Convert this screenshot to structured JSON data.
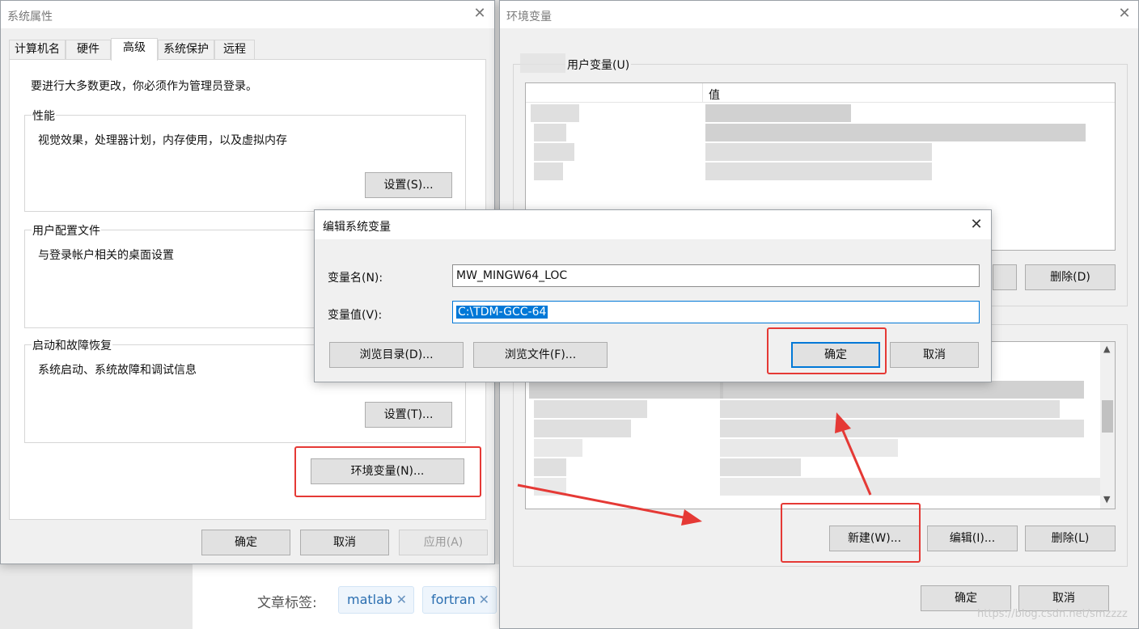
{
  "sysprop": {
    "title": "系统属性",
    "tabs": [
      "计算机名",
      "硬件",
      "高级",
      "系统保护",
      "远程"
    ],
    "admin_note": "要进行大多数更改，你必须作为管理员登录。",
    "perf": {
      "label": "性能",
      "desc": "视觉效果，处理器计划，内存使用，以及虚拟内存",
      "button": "设置(S)..."
    },
    "profile": {
      "label": "用户配置文件",
      "desc": "与登录帐户相关的桌面设置"
    },
    "startup": {
      "label": "启动和故障恢复",
      "desc": "系统启动、系统故障和调试信息",
      "button": "设置(T)..."
    },
    "envvar_button": "环境变量(N)...",
    "ok": "确定",
    "cancel": "取消",
    "apply": "应用(A)"
  },
  "envwin": {
    "title": "环境变量",
    "user_group_label": "用户变量(U)",
    "col_value": "值",
    "user_delete": "删除(D)",
    "sys_new": "新建(W)...",
    "sys_edit": "编辑(I)...",
    "sys_delete": "删除(L)",
    "ok": "确定",
    "cancel": "取消"
  },
  "editdlg": {
    "title": "编辑系统变量",
    "name_label": "变量名(N):",
    "name_value": "MW_MINGW64_LOC",
    "value_label": "变量值(V):",
    "value_value": "C:\\TDM-GCC-64",
    "browse_dir": "浏览目录(D)...",
    "browse_file": "浏览文件(F)...",
    "ok": "确定",
    "cancel": "取消"
  },
  "page": {
    "tags_label": "文章标签:",
    "tags": [
      "matlab",
      "fortran"
    ],
    "watermark": "https://blog.csdn.net/smzzzz"
  },
  "colors": {
    "accent": "#0078d7",
    "highlight": "#e53935",
    "tag_text": "#2a6eb0"
  },
  "icons": {
    "close": "close-icon",
    "scroll_up": "chevron-up-icon",
    "scroll_down": "chevron-down-icon",
    "tag_remove": "close-icon"
  }
}
